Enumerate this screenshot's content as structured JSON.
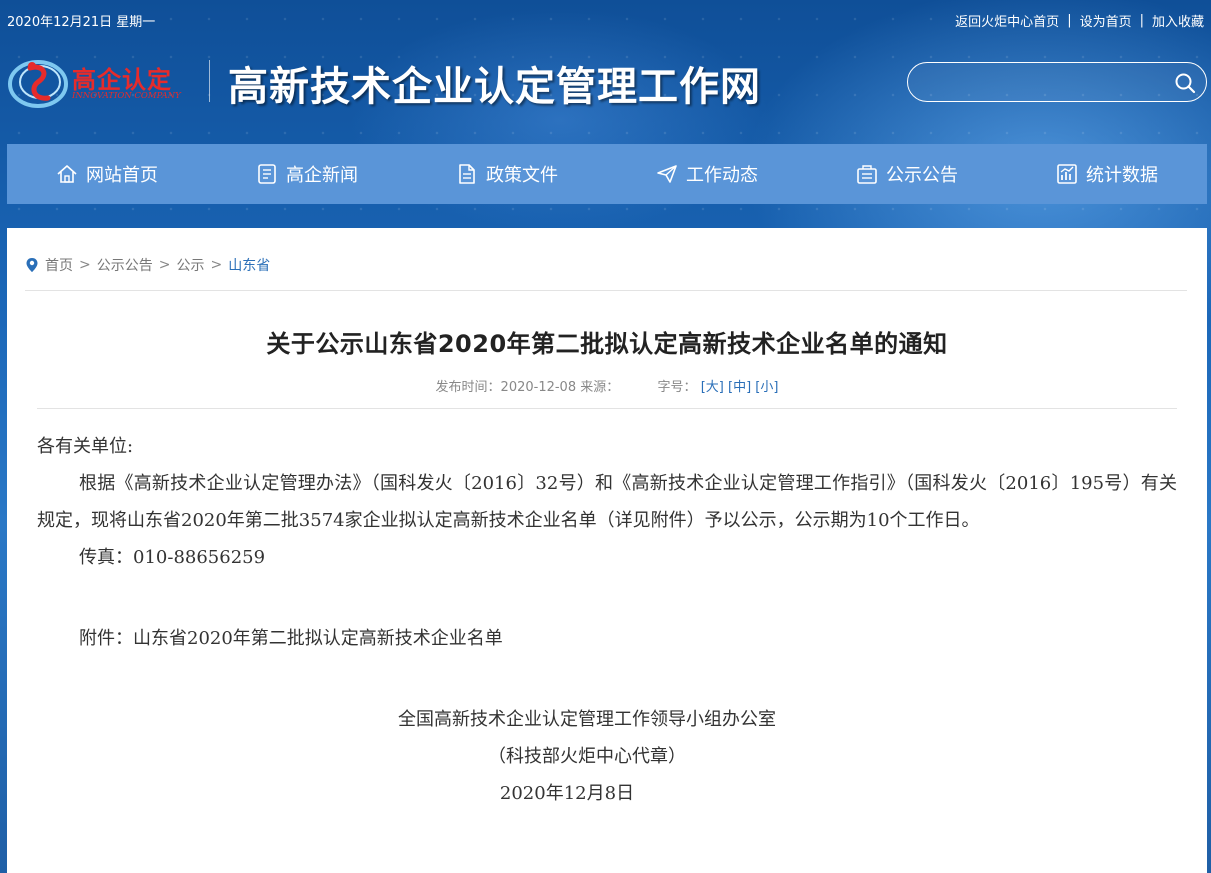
{
  "topbar": {
    "date": "2020年12月21日 星期一",
    "links": [
      "返回火炬中心首页",
      "设为首页",
      "加入收藏"
    ]
  },
  "header": {
    "logo_cn": "高企认定",
    "logo_en": "INNOVATION COMPANY",
    "site_title": "高新技术企业认定管理工作网",
    "search": {
      "value": "",
      "placeholder": ""
    }
  },
  "nav": [
    {
      "label": "网站首页",
      "icon": "home-icon"
    },
    {
      "label": "高企新闻",
      "icon": "news-icon"
    },
    {
      "label": "政策文件",
      "icon": "document-icon"
    },
    {
      "label": "工作动态",
      "icon": "paper-plane-icon"
    },
    {
      "label": "公示公告",
      "icon": "notice-icon"
    },
    {
      "label": "统计数据",
      "icon": "chart-icon"
    }
  ],
  "breadcrumb": {
    "items": [
      "首页",
      "公示公告",
      "公示"
    ],
    "current": "山东省",
    "separator": ">"
  },
  "article": {
    "title": "关于公示山东省2020年第二批拟认定高新技术企业名单的通知",
    "meta": {
      "published": "发布时间：2020-12-08",
      "source": "来源：",
      "font_size_label": "字号：",
      "font_sizes": [
        "[大]",
        "[中]",
        "[小]"
      ]
    },
    "body": {
      "greeting": "各有关单位:",
      "paragraph": "根据《高新技术企业认定管理办法》（国科发火〔2016〕32号）和《高新技术企业认定管理工作指引》（国科发火〔2016〕195号）有关规定，现将山东省2020年第二批3574家企业拟认定高新技术企业名单（详见附件）予以公示，公示期为10个工作日。",
      "fax": "传真：010-88656259",
      "attachment": "附件：山东省2020年第二批拟认定高新技术企业名单",
      "signature_org": "全国高新技术企业认定管理工作领导小组办公室",
      "signature_note": "（科技部火炬中心代章）",
      "signature_date": "2020年12月8日"
    }
  },
  "colors": {
    "banner": "#1f5fa6",
    "nav": "#5a95d8",
    "logo_red": "#e62b2b",
    "link_blue": "#2a6fb8"
  }
}
